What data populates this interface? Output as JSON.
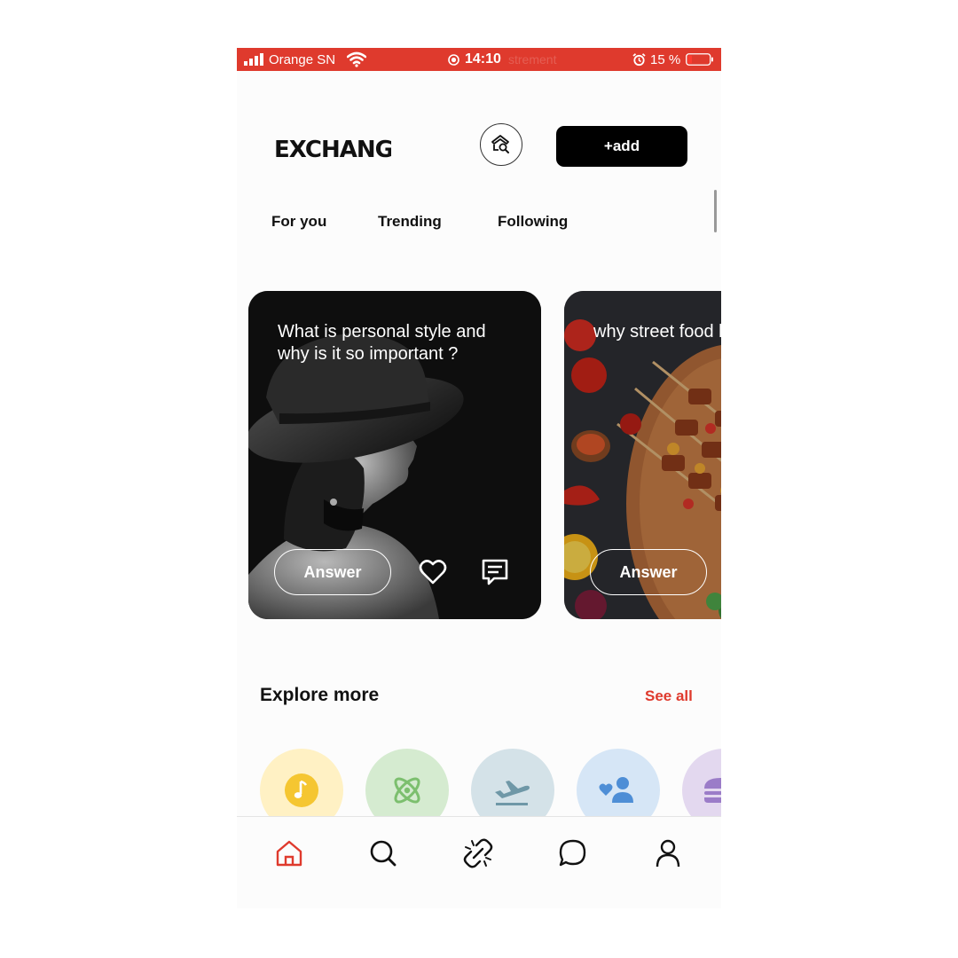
{
  "status_bar": {
    "carrier": "Orange SN",
    "time": "14:10",
    "ghost_text": "strement",
    "battery": "15 %",
    "icons": [
      "signal-icon",
      "wifi-icon",
      "recording-icon",
      "alarm-icon",
      "battery-icon"
    ]
  },
  "header": {
    "logo": "EXCHANGE",
    "search_icon": "search-icon",
    "add_label": "+add"
  },
  "tabs": [
    {
      "label": "For you"
    },
    {
      "label": "Trending"
    },
    {
      "label": "Following"
    }
  ],
  "cards": [
    {
      "question": "What is personal style and why is it so important ?",
      "answer_label": "Answer",
      "icons": [
        "heart-icon",
        "comment-icon"
      ]
    },
    {
      "question": "why street food banned ?",
      "answer_label": "Answer"
    }
  ],
  "explore": {
    "title": "Explore more",
    "see_all": "See all",
    "categories": [
      {
        "icon": "music-icon",
        "color": "#fff1c4",
        "accent": "#f5c631"
      },
      {
        "icon": "science-icon",
        "color": "#d5ebd0",
        "accent": "#7cbf6e"
      },
      {
        "icon": "travel-icon",
        "color": "#d4e2e8",
        "accent": "#6f98a7"
      },
      {
        "icon": "social-icon",
        "color": "#d6e6f6",
        "accent": "#4e8ed6"
      },
      {
        "icon": "food-icon",
        "color": "#e3d8ef",
        "accent": "#9b7cc8"
      }
    ]
  },
  "bottom_nav": [
    {
      "icon": "home-icon",
      "active": true
    },
    {
      "icon": "search-icon"
    },
    {
      "icon": "connect-icon"
    },
    {
      "icon": "chat-icon"
    },
    {
      "icon": "profile-icon"
    }
  ],
  "colors": {
    "brand": "#df3a2d",
    "text": "#111111",
    "background": "#fcfcfc"
  }
}
